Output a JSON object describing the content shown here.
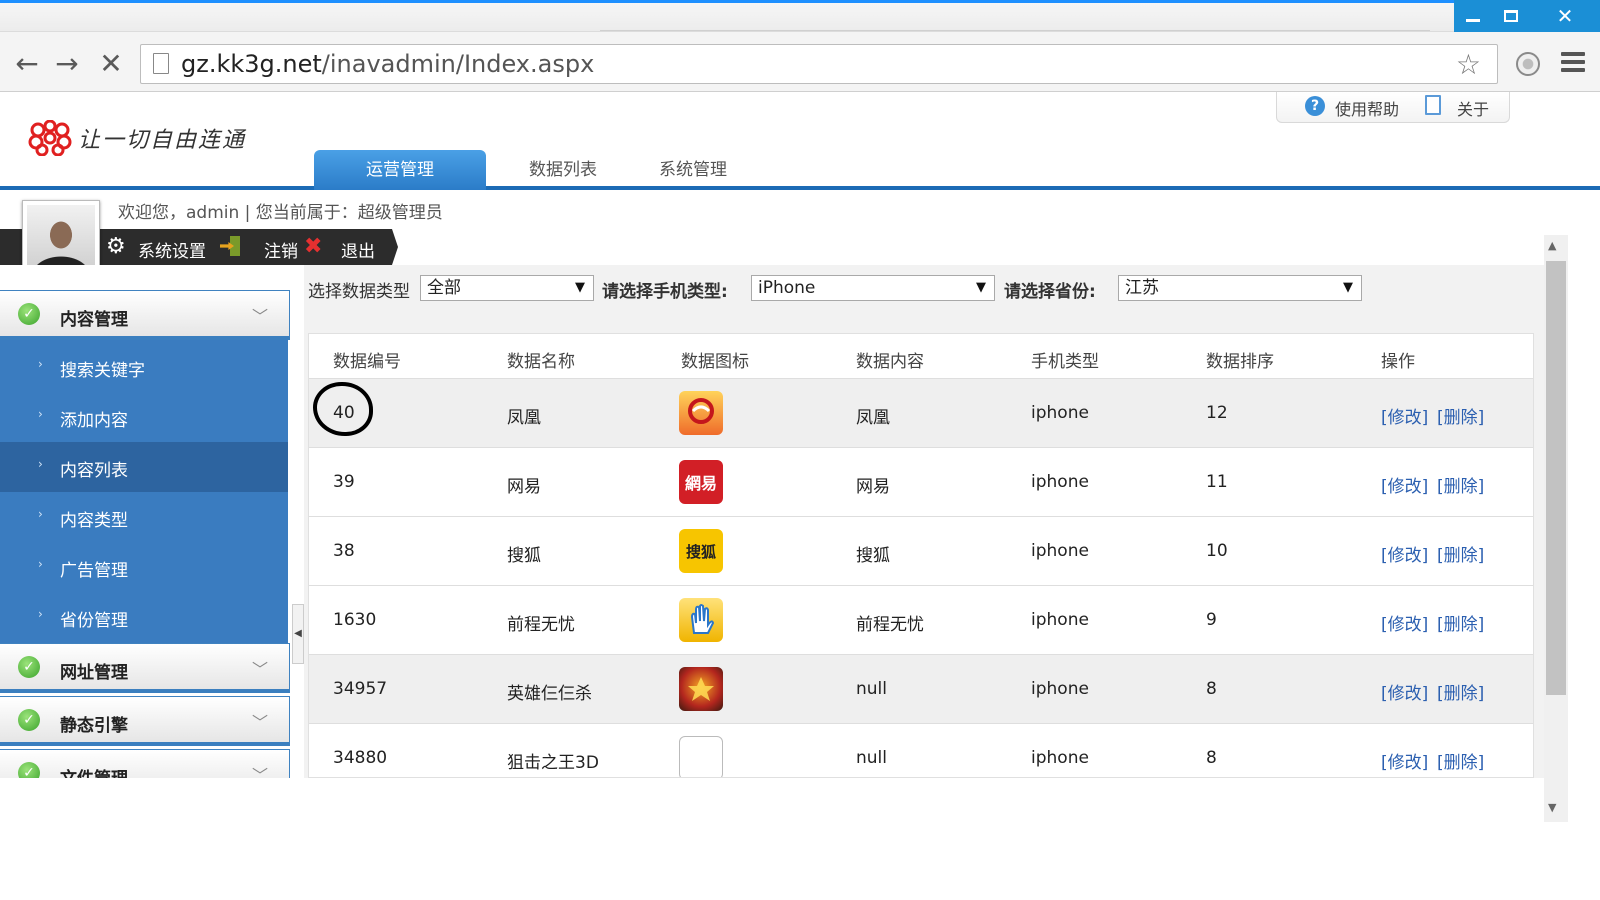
{
  "browser": {
    "url_host": "gz.kk3g.net",
    "url_path": "/inavadmin/Index.aspx"
  },
  "header": {
    "slogan": "让一切自由连通",
    "help_label": "使用帮助",
    "about_label": "关于",
    "tabs": [
      "运营管理",
      "数据列表",
      "系统管理"
    ],
    "brand_color": "#1c6bb5"
  },
  "user": {
    "welcome": "欢迎您，admin | 您当前属于：超级管理员",
    "settings_label": "系统设置",
    "logoff_label": "注销",
    "exit_label": "退出"
  },
  "sidebar": {
    "groups": [
      {
        "label": "内容管理"
      },
      {
        "label": "网址管理"
      },
      {
        "label": "静态引擎"
      },
      {
        "label": "文件管理"
      }
    ],
    "items": [
      {
        "label": "搜索关键字"
      },
      {
        "label": "添加内容"
      },
      {
        "label": "内容列表"
      },
      {
        "label": "内容类型"
      },
      {
        "label": "广告管理"
      },
      {
        "label": "省份管理"
      }
    ]
  },
  "filters": {
    "type_label": "选择数据类型",
    "type_value": "全部",
    "phone_label": "请选择手机类型:",
    "phone_value": "iPhone",
    "province_label": "请选择省份:",
    "province_value": "江苏"
  },
  "table": {
    "headers": [
      "数据编号",
      "数据名称",
      "数据图标",
      "数据内容",
      "手机类型",
      "数据排序",
      "操作"
    ],
    "edit_label": "[修改]",
    "delete_label": "[删除]",
    "rows": [
      {
        "id": "40",
        "name": "凤凰",
        "icon": "ifeng-news-icon",
        "content": "凤凰",
        "phone": "iphone",
        "order": "12"
      },
      {
        "id": "39",
        "name": "网易",
        "icon": "netease-icon",
        "content": "网易",
        "phone": "iphone",
        "order": "11"
      },
      {
        "id": "38",
        "name": "搜狐",
        "icon": "sohu-icon",
        "content": "搜狐",
        "phone": "iphone",
        "order": "10"
      },
      {
        "id": "1630",
        "name": "前程无忧",
        "icon": "51job-icon",
        "content": "前程无忧",
        "phone": "iphone",
        "order": "9"
      },
      {
        "id": "34957",
        "name": "英雄仨仨杀",
        "icon": "hero-game-icon",
        "content": "null",
        "phone": "iphone",
        "order": "8"
      },
      {
        "id": "34880",
        "name": "狙击之王3D",
        "icon": "blank-icon",
        "content": "null",
        "phone": "iphone",
        "order": "8"
      }
    ],
    "icon_texts": {
      "netease": "網易",
      "sohu": "搜狐"
    }
  }
}
